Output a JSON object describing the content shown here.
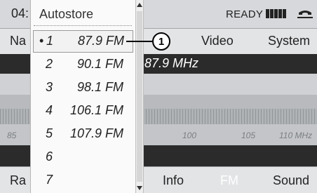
{
  "status_bar": {
    "time_partial": "04:",
    "ready_text": "READY",
    "signal_icon": "signal-strength-icon",
    "phone_icon": "phone-handset-icon"
  },
  "menu_bar": {
    "items": [
      "Na",
      "Video",
      "System"
    ]
  },
  "frequency_readout": "87.9 MHz",
  "scale_labels": [
    "85",
    "100",
    "105",
    "110 MHz"
  ],
  "bottom_bar": {
    "items": [
      "Ra",
      "Info",
      "FM",
      "Sound"
    ],
    "active_item": "FM"
  },
  "autostore": {
    "title": "Autostore",
    "selected_index": 0,
    "presets": [
      {
        "bullet": "•",
        "number": "1",
        "frequency": "87.9 FM"
      },
      {
        "bullet": "",
        "number": "2",
        "frequency": "90.1 FM"
      },
      {
        "bullet": "",
        "number": "3",
        "frequency": "98.1 FM"
      },
      {
        "bullet": "",
        "number": "4",
        "frequency": "106.1 FM"
      },
      {
        "bullet": "",
        "number": "5",
        "frequency": "107.9 FM"
      },
      {
        "bullet": "",
        "number": "6",
        "frequency": ""
      },
      {
        "bullet": "",
        "number": "7",
        "frequency": ""
      }
    ]
  },
  "callout": {
    "number": "1"
  },
  "colors": {
    "screen_background": "#c3c5c8",
    "menu_background": "#e3e4e6",
    "dark_band": "#2b2b2b",
    "dropdown_background": "#fafafa",
    "active_text": "#ffffff"
  }
}
